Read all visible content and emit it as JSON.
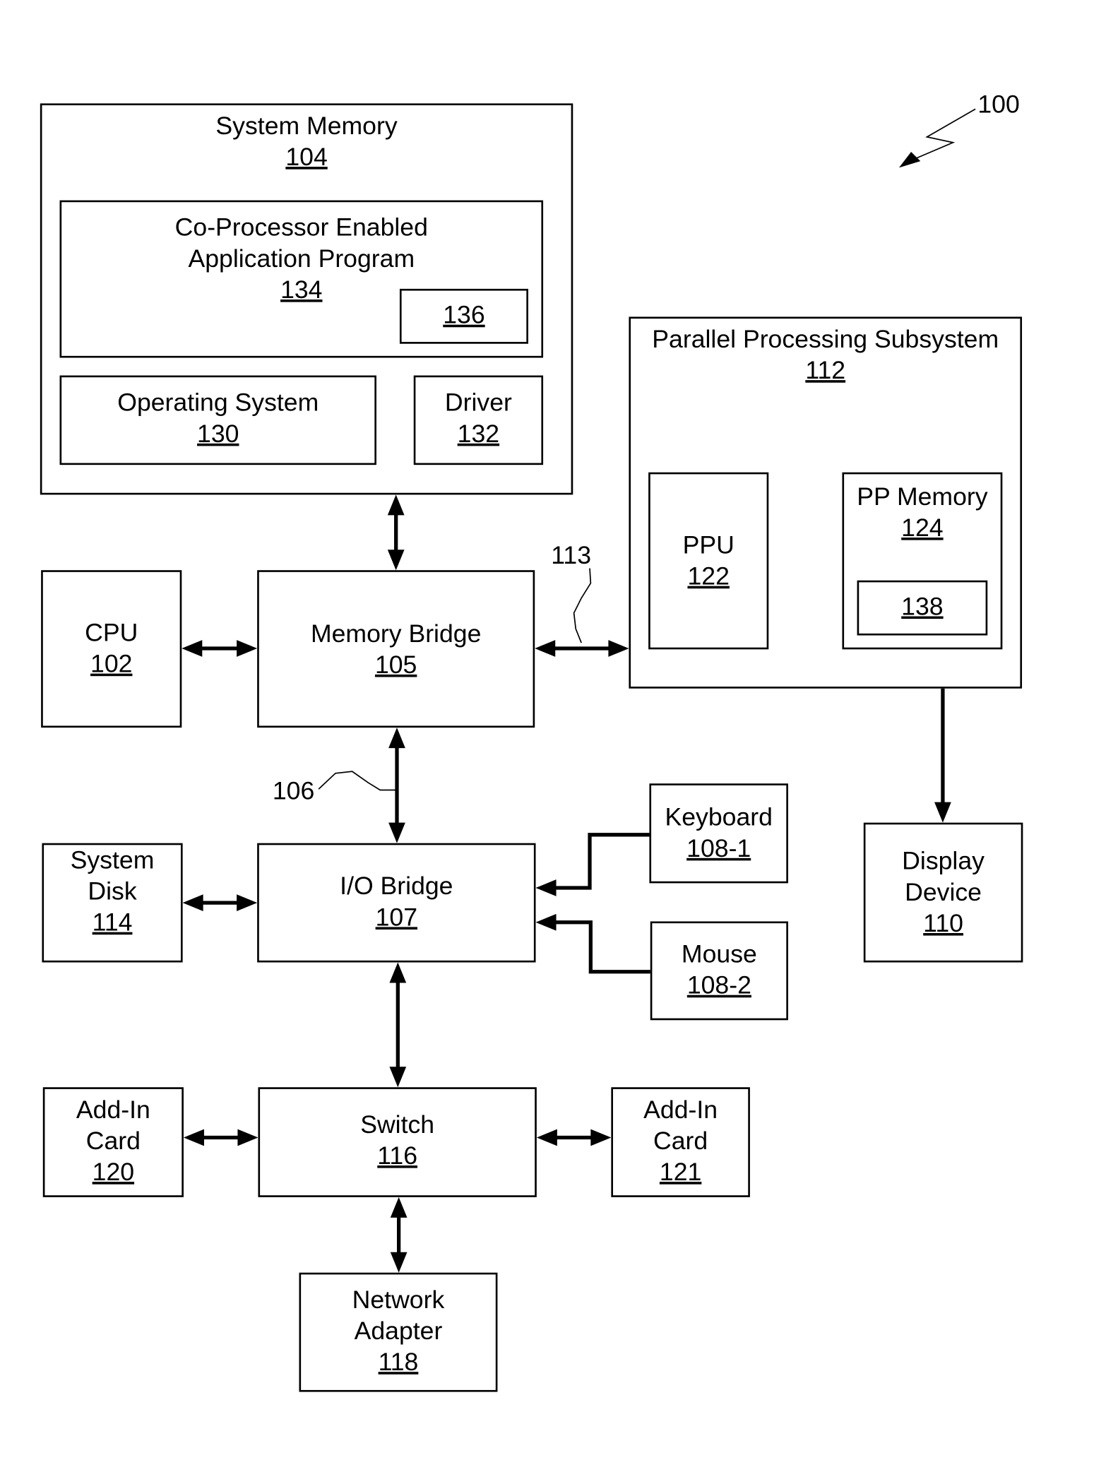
{
  "figure": {
    "ref": "100",
    "pointer_icon": "lightning-arrow-icon"
  },
  "components": {
    "system_memory": {
      "lines": [
        "System Memory"
      ],
      "ref": "104"
    },
    "app_program": {
      "lines": [
        "Co-Processor Enabled",
        "Application Program"
      ],
      "ref": "134"
    },
    "app_sub": {
      "lines": [],
      "ref": "136"
    },
    "operating_system": {
      "lines": [
        "Operating System"
      ],
      "ref": "130"
    },
    "driver": {
      "lines": [
        "Driver"
      ],
      "ref": "132"
    },
    "pps": {
      "lines": [
        "Parallel Processing Subsystem"
      ],
      "ref": "112"
    },
    "ppu": {
      "lines": [
        "PPU"
      ],
      "ref": "122"
    },
    "pp_memory": {
      "lines": [
        "PP Memory"
      ],
      "ref": "124"
    },
    "pp_sub": {
      "lines": [],
      "ref": "138"
    },
    "cpu": {
      "lines": [
        "CPU"
      ],
      "ref": "102"
    },
    "memory_bridge": {
      "lines": [
        "Memory Bridge"
      ],
      "ref": "105"
    },
    "display_device": {
      "lines": [
        "Display",
        "Device"
      ],
      "ref": "110"
    },
    "system_disk": {
      "lines": [
        "System",
        "Disk"
      ],
      "ref": "114"
    },
    "io_bridge": {
      "lines": [
        "I/O Bridge"
      ],
      "ref": "107"
    },
    "keyboard": {
      "lines": [
        "Keyboard"
      ],
      "ref": "108-1"
    },
    "mouse": {
      "lines": [
        "Mouse"
      ],
      "ref": "108-2"
    },
    "add_in_card_1": {
      "lines": [
        "Add-In",
        "Card"
      ],
      "ref": "120"
    },
    "switch": {
      "lines": [
        "Switch"
      ],
      "ref": "116"
    },
    "add_in_card_2": {
      "lines": [
        "Add-In",
        "Card"
      ],
      "ref": "121"
    },
    "network_adapter": {
      "lines": [
        "Network",
        "Adapter"
      ],
      "ref": "118"
    }
  },
  "bus_labels": {
    "communication_path": "113",
    "memory_io_path": "106"
  },
  "connections": [
    {
      "from": "system_memory",
      "to": "memory_bridge",
      "type": "bidirectional"
    },
    {
      "from": "cpu",
      "to": "memory_bridge",
      "type": "bidirectional"
    },
    {
      "from": "memory_bridge",
      "to": "pps",
      "type": "bidirectional",
      "label": "113"
    },
    {
      "from": "ppu",
      "to": "pp_memory",
      "type": "bidirectional"
    },
    {
      "from": "pps",
      "to": "display_device",
      "type": "unidirectional"
    },
    {
      "from": "memory_bridge",
      "to": "io_bridge",
      "type": "bidirectional",
      "label": "106"
    },
    {
      "from": "system_disk",
      "to": "io_bridge",
      "type": "bidirectional"
    },
    {
      "from": "keyboard",
      "to": "io_bridge",
      "type": "unidirectional"
    },
    {
      "from": "mouse",
      "to": "io_bridge",
      "type": "unidirectional"
    },
    {
      "from": "io_bridge",
      "to": "switch",
      "type": "bidirectional"
    },
    {
      "from": "add_in_card_1",
      "to": "switch",
      "type": "bidirectional"
    },
    {
      "from": "switch",
      "to": "add_in_card_2",
      "type": "bidirectional"
    },
    {
      "from": "switch",
      "to": "network_adapter",
      "type": "bidirectional"
    }
  ]
}
